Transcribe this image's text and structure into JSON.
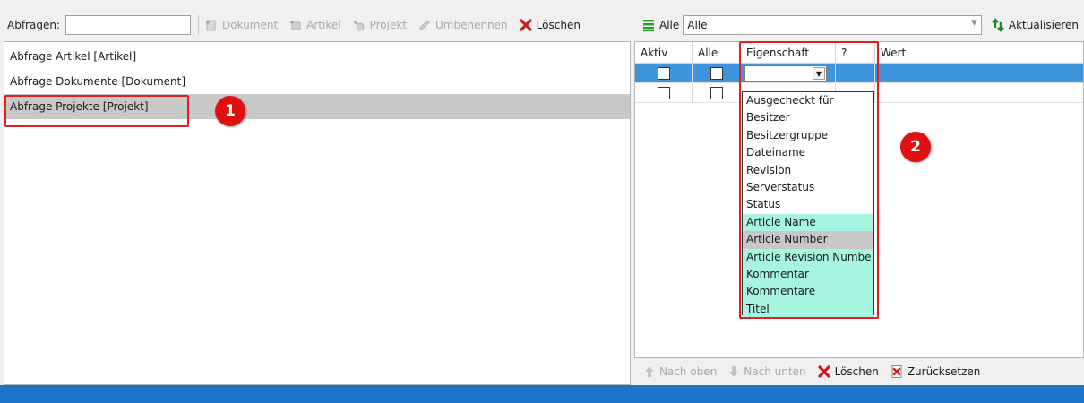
{
  "left_toolbar": {
    "search_label": "Abfragen:",
    "search_value": "",
    "buttons": {
      "dokument": "Dokument",
      "artikel": "Artikel",
      "projekt": "Projekt",
      "umbenennen": "Umbenennen",
      "loeschen": "Löschen"
    }
  },
  "right_toolbar": {
    "filter_label": "Alle",
    "filter_value": "Alle",
    "refresh": "Aktualisieren"
  },
  "queries": [
    {
      "label": "Abfrage Artikel [Artikel]"
    },
    {
      "label": "Abfrage Dokumente [Dokument]"
    },
    {
      "label": "Abfrage Projekte [Projekt]"
    }
  ],
  "grid": {
    "headers": {
      "aktiv": "Aktiv",
      "alle": "Alle",
      "eigenschaft": "Eigenschaft",
      "q": "?",
      "wert": "Wert"
    }
  },
  "dropdown": {
    "options": [
      "Ausgecheckt für",
      "Besitzer",
      "Besitzergruppe",
      "Dateiname",
      "Revision",
      "Serverstatus",
      "Status",
      "Article Name",
      "Article Number",
      "Article Revision Numbe",
      "Kommentar",
      "Kommentare",
      "Titel"
    ],
    "highlight_color": "#a5f5e0"
  },
  "bottom_toolbar": {
    "nach_oben": "Nach oben",
    "nach_unten": "Nach unten",
    "loeschen": "Löschen",
    "zuruecksetzen": "Zurücksetzen"
  },
  "annotations": {
    "badge1": "1",
    "badge2": "2"
  },
  "colors": {
    "selection": "#3f94de",
    "statusbar": "#1c75c8",
    "annotation": "#e02020"
  }
}
